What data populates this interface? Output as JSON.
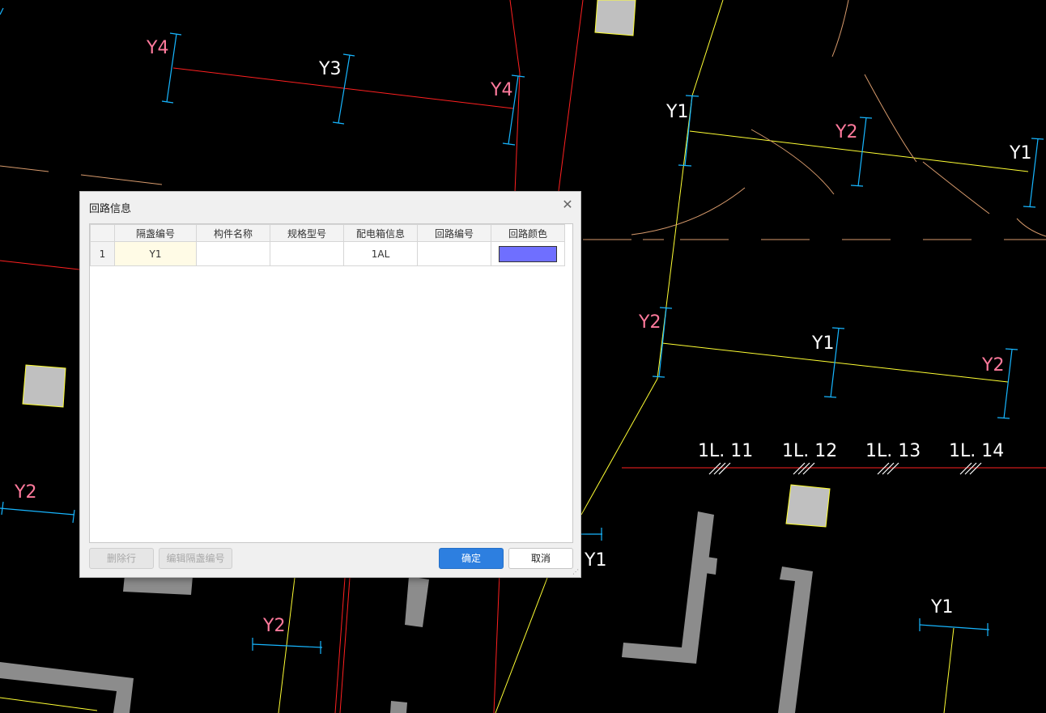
{
  "cad_labels": {
    "y4_a": "Y4",
    "y3": "Y3",
    "y4_b": "Y4",
    "y1_a": "Y1",
    "y2_a": "Y2",
    "y1_b": "Y1",
    "y2_b": "Y2",
    "y1_c": "Y1",
    "y2_c": "Y2",
    "y2_d": "Y2",
    "y2_e": "Y2",
    "y1_d": "Y1",
    "y1_e": "Y1",
    "l11": "1L. 11",
    "l12": "1L. 12",
    "l13": "1L. 13",
    "l14": "1L. 14"
  },
  "colors": {
    "label_pink": "#ff7a9c",
    "label_white": "#ffffff",
    "dialog_primary": "#2d7fe0"
  },
  "dialog": {
    "title": "回路信息",
    "close_icon": "close-icon",
    "columns": [
      "",
      "隔盏编号",
      "构件名称",
      "规格型号",
      "配电箱信息",
      "回路编号",
      "回路颜色"
    ],
    "rows": [
      {
        "index": "1",
        "id": "Y1",
        "name": "",
        "model": "",
        "box": "1AL",
        "circuit": "",
        "color": "#6f6fff"
      }
    ],
    "buttons": {
      "delete_row": "删除行",
      "edit_id": "编辑隔盏编号",
      "ok": "确定",
      "cancel": "取消"
    }
  }
}
